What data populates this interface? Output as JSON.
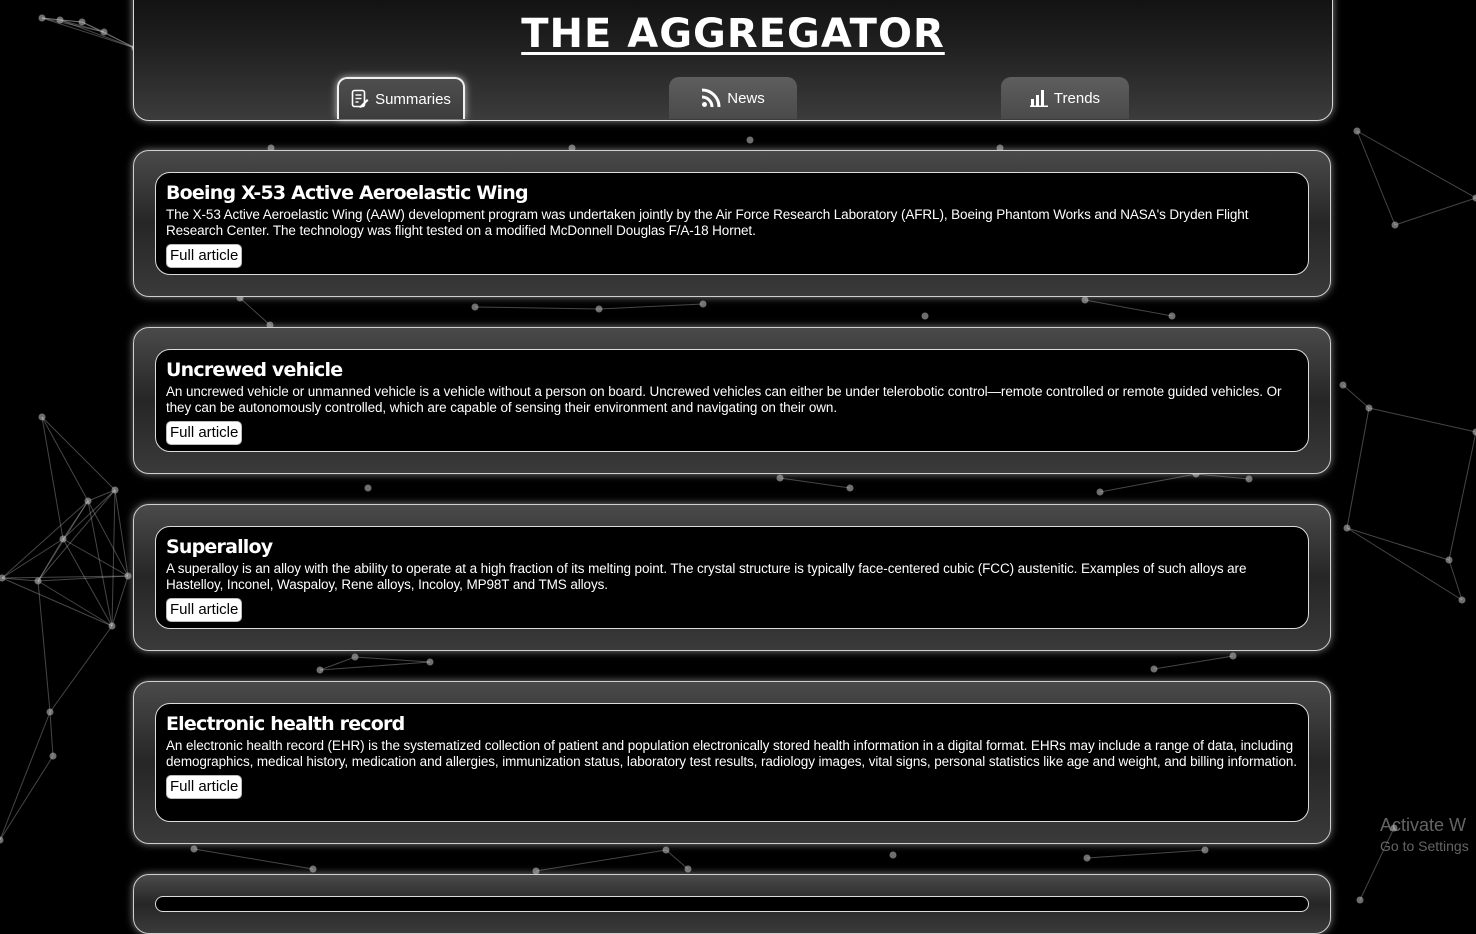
{
  "app": {
    "title": "THE AGGREGATOR"
  },
  "tabs": [
    {
      "label": "Summaries",
      "icon": "document-edit-icon",
      "active": true
    },
    {
      "label": "News",
      "icon": "rss-icon",
      "active": false
    },
    {
      "label": "Trends",
      "icon": "bar-chart-icon",
      "active": false
    }
  ],
  "articles": [
    {
      "title": "Boeing X-53 Active Aeroelastic Wing",
      "summary": "The X-53 Active Aeroelastic Wing (AAW) development program was undertaken jointly by the Air Force Research Laboratory (AFRL), Boeing Phantom Works and NASA's Dryden Flight Research Center. The technology was flight tested on a modified McDonnell Douglas F/A-18 Hornet.",
      "link_label": "Full article"
    },
    {
      "title": "Uncrewed vehicle",
      "summary": "An uncrewed vehicle or unmanned vehicle is a vehicle without a person on board. Uncrewed vehicles can either be under telerobotic control—remote controlled or remote guided vehicles. Or they can be autonomously controlled, which are capable of sensing their environment and navigating on their own.",
      "link_label": "Full article"
    },
    {
      "title": "Superalloy",
      "summary": "A superalloy is an alloy with the ability to operate at a high fraction of its melting point. The crystal structure is typically face-centered cubic (FCC) austenitic. Examples of such alloys are Hastelloy, Inconel, Waspaloy, Rene alloys, Incoloy, MP98T and TMS alloys.",
      "link_label": "Full article"
    },
    {
      "title": "Electronic health record",
      "summary": "An electronic health record (EHR) is the systematized collection of patient and population electronically stored health information in a digital format. EHRs may include a range of data, including demographics, medical history, medication and allergies, immunization status, laboratory test results, radiology images, vital signs, personal statistics like age and weight, and billing information.",
      "link_label": "Full article"
    }
  ],
  "watermark": {
    "line1": "Activate W",
    "line2": "Go to Settings"
  }
}
